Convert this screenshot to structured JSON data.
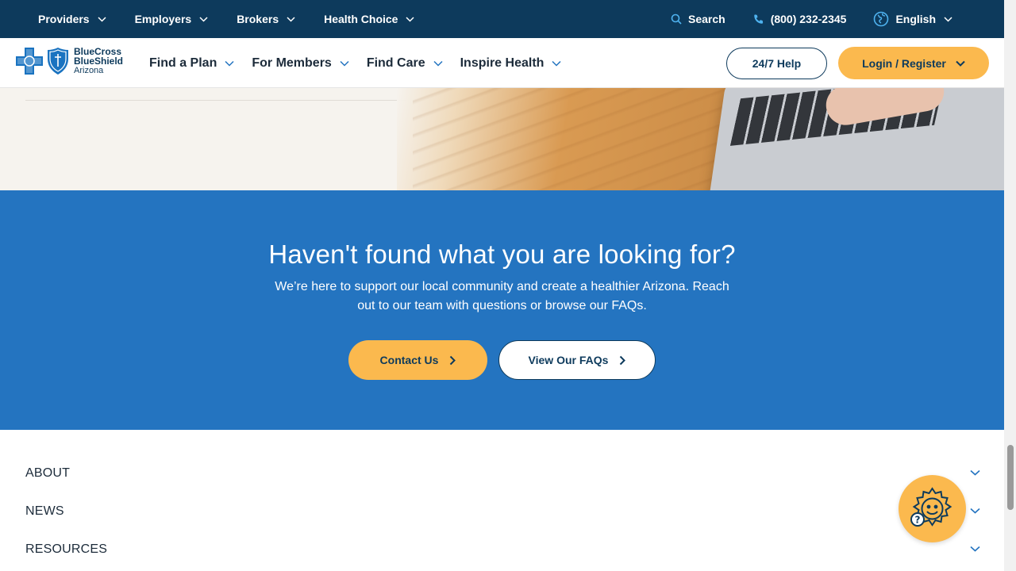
{
  "topbar": {
    "items": [
      {
        "label": "Providers"
      },
      {
        "label": "Employers"
      },
      {
        "label": "Brokers"
      },
      {
        "label": "Health Choice"
      }
    ],
    "search_label": "Search",
    "phone": "(800) 232-2345",
    "language": "English"
  },
  "logo": {
    "line1": "BlueCross",
    "line2": "BlueShield",
    "line3": "Arizona"
  },
  "mainnav": {
    "items": [
      {
        "label": "Find a Plan"
      },
      {
        "label": "For Members"
      },
      {
        "label": "Find Care"
      },
      {
        "label": "Inspire Health"
      }
    ],
    "help_label": "24/7 Help",
    "login_label": "Login / Register"
  },
  "cta": {
    "heading": "Haven't found what you are looking for?",
    "body": "We’re here to support our local community and create a healthier Arizona. Reach out to our team with questions or browse our FAQs.",
    "contact_label": "Contact Us",
    "faq_label": "View Our FAQs"
  },
  "footer": {
    "sections": [
      {
        "label": "ABOUT"
      },
      {
        "label": "NEWS"
      },
      {
        "label": "RESOURCES"
      }
    ]
  },
  "colors": {
    "navy": "#0d3a5c",
    "blue": "#2474c0",
    "gold": "#fbb94e"
  },
  "icons": [
    "search-icon",
    "phone-icon",
    "globe-icon",
    "chevron-down-icon",
    "chevron-right-icon",
    "sun-chat-icon"
  ]
}
